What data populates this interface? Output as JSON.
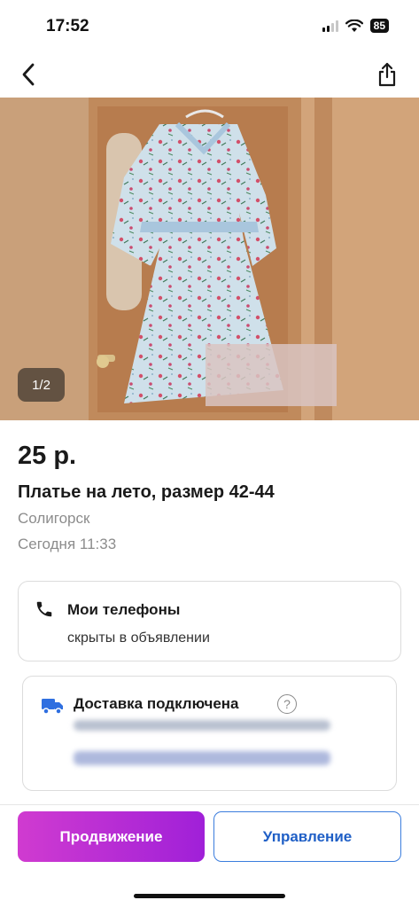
{
  "status_bar": {
    "time": "17:52",
    "battery": "85"
  },
  "nav": {
    "back_icon": "chevron-left-icon",
    "share_icon": "share-icon"
  },
  "photo": {
    "counter": "1/2"
  },
  "listing": {
    "price": "25 р.",
    "title": "Платье на лето, размер 42-44",
    "city": "Солигорск",
    "date": "Сегодня 11:33"
  },
  "phones": {
    "title": "Мои телефоны",
    "subtitle": "скрыты в объявлении"
  },
  "delivery": {
    "title": "Доставка подключена",
    "help": "?"
  },
  "actions": {
    "promote_label": "Продвижение",
    "manage_label": "Управление"
  },
  "colors": {
    "promote_gradient_start": "#d03bd0",
    "promote_gradient_end": "#a020d8",
    "manage_border": "#3b7ddd",
    "delivery_icon": "#2f6fe0"
  }
}
